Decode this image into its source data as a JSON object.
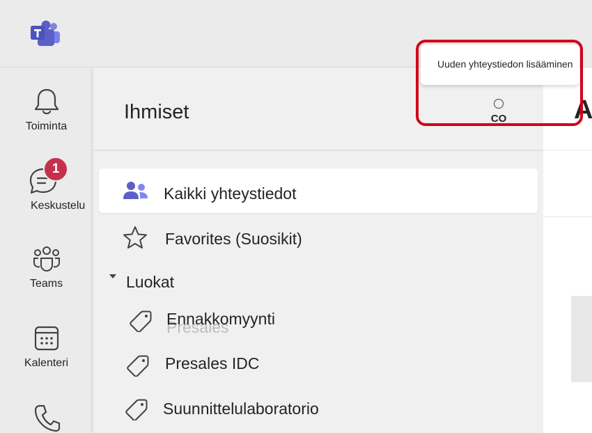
{
  "app": {
    "logo": "microsoft-teams-logo"
  },
  "rail": {
    "items": [
      {
        "label": "Toiminta",
        "icon": "bell-icon"
      },
      {
        "label": "Keskustelu",
        "icon": "chat-icon",
        "badge": "1"
      },
      {
        "label": "Teams",
        "icon": "teams-icon"
      },
      {
        "label": "Kalenteri",
        "icon": "calendar-icon"
      },
      {
        "label": "",
        "icon": "phone-icon"
      }
    ]
  },
  "panel": {
    "title": "Ihmiset",
    "nav": {
      "all_contacts": "Kaikki yhteystiedot",
      "favorites": "Favorites (Suosikit)",
      "categories_header": "Luokat",
      "categories": [
        "Ennakkomyynti",
        "Presales IDC",
        "Suunnittelulaboratorio"
      ]
    }
  },
  "toolbar": {
    "tooltip": "Uuden yhteystiedon lisääminen",
    "add_contact_label": "CO"
  },
  "right_pane": {
    "heading_letter": "A"
  },
  "colors": {
    "accent": "#5b5fc7",
    "badge": "#c4314b",
    "highlight_frame": "#d0021b"
  }
}
